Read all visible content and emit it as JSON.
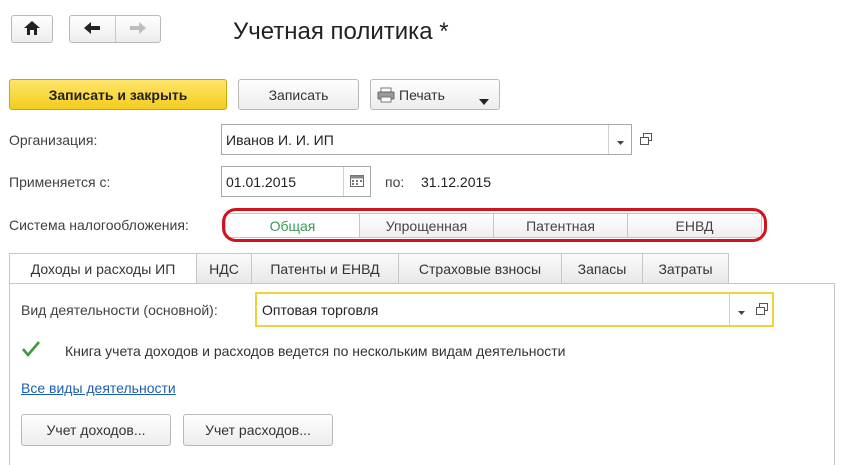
{
  "window": {
    "title": "Учетная политика *"
  },
  "toolbar": {
    "save_close_label": "Записать и закрыть",
    "save_label": "Записать",
    "print_label": "Печать"
  },
  "form": {
    "organization": {
      "label": "Организация:",
      "value": "Иванов И. И. ИП"
    },
    "applies_from": {
      "label": "Применяется с:",
      "value": "01.01.2015",
      "to_label": "по:",
      "to_value": "31.12.2015"
    },
    "tax_system": {
      "label": "Система налогообложения:",
      "options": [
        "Общая",
        "Упрощенная",
        "Патентная",
        "ЕНВД"
      ],
      "selected": "Общая"
    }
  },
  "tabs": [
    {
      "label": "Доходы и расходы ИП",
      "active": true
    },
    {
      "label": "НДС"
    },
    {
      "label": "Патенты и ЕНВД"
    },
    {
      "label": "Страховые взносы"
    },
    {
      "label": "Запасы"
    },
    {
      "label": "Затраты"
    }
  ],
  "panel": {
    "activity": {
      "label": "Вид деятельности (основной):",
      "value": "Оптовая торговля"
    },
    "multi_activity": {
      "label": "Книга учета доходов и расходов ведется по нескольким видам деятельности",
      "checked": true
    },
    "all_activities_link": "Все виды деятельности",
    "income_button": "Учет доходов...",
    "expense_button": "Учет расходов..."
  },
  "colors": {
    "accent_yellow": "#f4cc1e",
    "highlight_red": "#d0141c",
    "selected_green": "#3a9b52",
    "link_blue": "#1c5fb3"
  }
}
